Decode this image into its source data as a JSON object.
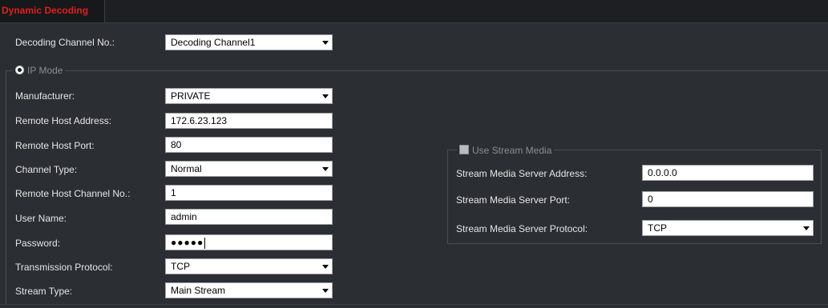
{
  "header": {
    "title": "Dynamic Decoding"
  },
  "decoding_channel": {
    "label": "Decoding Channel No.:",
    "value": "Decoding Channel1"
  },
  "ip_mode": {
    "legend": "IP Mode",
    "manufacturer": {
      "label": "Manufacturer:",
      "value": "PRIVATE"
    },
    "remote_host_address": {
      "label": "Remote Host Address:",
      "value": "172.6.23.123"
    },
    "remote_host_port": {
      "label": "Remote Host Port:",
      "value": "80"
    },
    "channel_type": {
      "label": "Channel Type:",
      "value": "Normal"
    },
    "remote_host_channel_no": {
      "label": "Remote Host Channel No.:",
      "value": "1"
    },
    "user_name": {
      "label": "User Name:",
      "value": "admin"
    },
    "password": {
      "label": "Password:",
      "value": "●●●●●"
    },
    "transmission_protocol": {
      "label": "Transmission Protocol:",
      "value": "TCP"
    },
    "stream_type": {
      "label": "Stream Type:",
      "value": "Main Stream"
    }
  },
  "stream_media": {
    "legend": "Use Stream Media",
    "server_address": {
      "label": "Stream Media Server Address:",
      "value": "0.0.0.0"
    },
    "server_port": {
      "label": "Stream Media Server Port:",
      "value": "0"
    },
    "server_protocol": {
      "label": "Stream Media Server Protocol:",
      "value": "TCP"
    }
  }
}
